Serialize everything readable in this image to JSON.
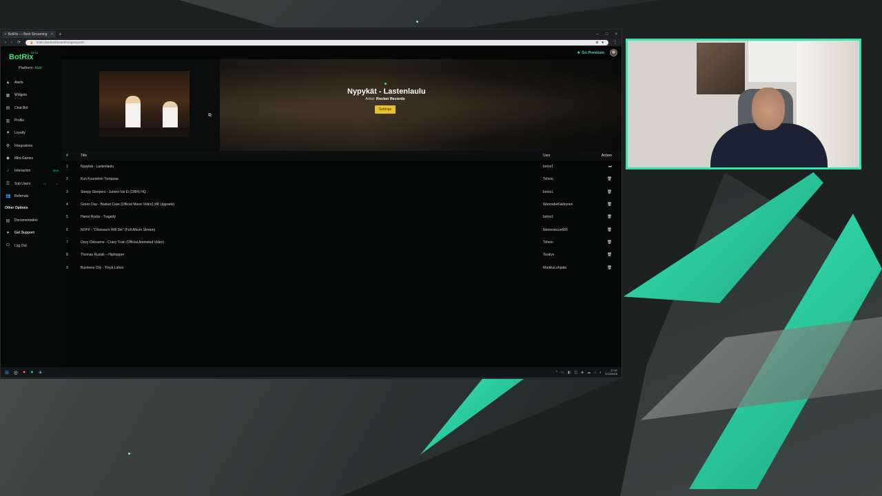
{
  "browser": {
    "tab_title": "BotRix — Best Streaming",
    "new_tab": "+",
    "window_controls": [
      "–",
      "□",
      "×"
    ],
    "url": "botrix.live/dashboard/songrequests",
    "nav": [
      "‹",
      "›",
      "⟳"
    ]
  },
  "app": {
    "brand": "BotRix",
    "beta": "BETA",
    "platform_label": "Platform:",
    "platform_value": "Kick",
    "go_premium": "Go Premium"
  },
  "sidebar": {
    "items": [
      {
        "label": "Alerts",
        "icon": "▲"
      },
      {
        "label": "Widgets",
        "icon": "▦"
      },
      {
        "label": "Chat Bot",
        "icon": "▤"
      },
      {
        "label": "Profile",
        "icon": "▥"
      },
      {
        "label": "Loyalty",
        "icon": "♥"
      },
      {
        "label": "Integrations",
        "icon": "⚙"
      },
      {
        "label": "Mini-Games",
        "icon": "◆"
      },
      {
        "label": "Interaction",
        "icon": "♪",
        "badge": "NEW"
      },
      {
        "label": "Sub Users",
        "icon": "☰",
        "toggle": "• •",
        "expand": "⌄"
      },
      {
        "label": "Referrals",
        "icon": "👥"
      }
    ],
    "other_title": "Other Options",
    "other_items": [
      {
        "label": "Documentation",
        "icon": "▤"
      },
      {
        "label": "Get Support",
        "icon": "●"
      },
      {
        "label": "Log Out",
        "icon": "⏻"
      }
    ]
  },
  "now_playing": {
    "title": "Nypykät - Lastenlaulu",
    "artist_label": "Artist:",
    "artist": "Rocket Records",
    "settings": "Settings"
  },
  "queue": {
    "headers": {
      "num": "#",
      "title": "Title",
      "user": "User",
      "action": "Action"
    },
    "rows": [
      {
        "num": "1",
        "title": "Nypykät - Lastenlaulu",
        "user": "botox1",
        "action": "⏭"
      },
      {
        "num": "2",
        "title": "Kun Kuuntelen Tomppaa",
        "user": "Toheio",
        "action": "🗑"
      },
      {
        "num": "3",
        "title": "Sleepy Sleepers - Jurkeo Vai Ei (1984) HQ",
        "user": "botox1",
        "action": "🗑"
      },
      {
        "num": "4",
        "title": "Green Day - Basket Case [Official Music Video] (4K Upgrade)",
        "user": "WannabeKakkonen",
        "action": "🗑"
      },
      {
        "num": "5",
        "title": "Hanoi Rocks - Tragedy",
        "user": "botox1",
        "action": "🗑"
      },
      {
        "num": "6",
        "title": "NOFX - \"Dinosaurs Will Die\" (Full Album Stream)",
        "user": "Nemesiscuo666",
        "action": "🗑"
      },
      {
        "num": "7",
        "title": "Ozzy Osbourne - Crazy Train (Official Animated Video)",
        "user": "Toheio",
        "action": "🗑"
      },
      {
        "num": "8",
        "title": "Thomas Rusiak – Hiphopper",
        "user": "Tosikyx",
        "action": "🗑"
      },
      {
        "num": "9",
        "title": "Business City - Yrsyä Lahes",
        "user": "MarkkuLohjalta",
        "action": "🗑"
      }
    ]
  },
  "taskbar": {
    "icons": [
      "⊞",
      "◎",
      "●",
      "●",
      "✈"
    ],
    "tray": [
      "^",
      "▭",
      "◧",
      "◫",
      "◈",
      "☁",
      "⌂",
      "◐"
    ],
    "time": "17:41",
    "date": "2/13/2025"
  },
  "colors": {
    "accent": "#3fe07f",
    "settings": "#e5c12d",
    "cam_border": "#2ee8b0",
    "premium": "#4ad7c0"
  }
}
